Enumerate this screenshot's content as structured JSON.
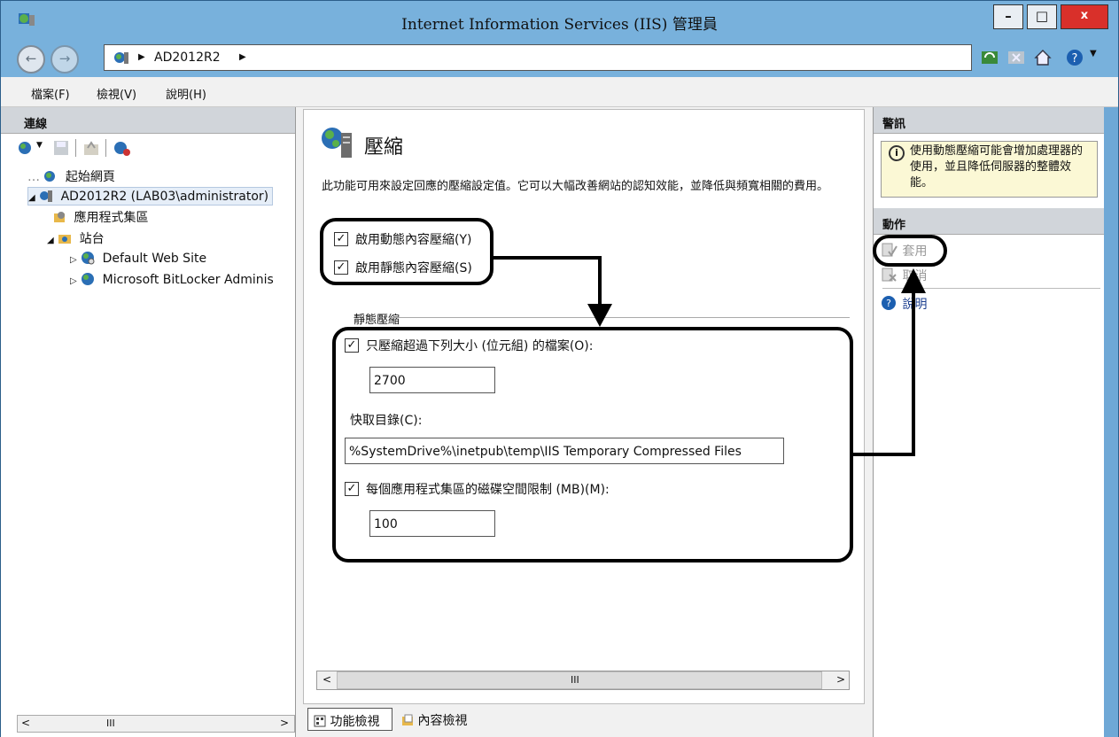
{
  "window": {
    "title": "Internet Information Services (IIS) 管理員",
    "minimize_label": "–",
    "maximize_label": "□",
    "close_label": "x"
  },
  "address": {
    "path": "AD2012R2"
  },
  "menu": {
    "items": [
      "檔案(F)",
      "檢視(V)",
      "說明(H)"
    ]
  },
  "connections": {
    "header": "連線",
    "tree": [
      {
        "label": "起始網頁"
      },
      {
        "label": "AD2012R2 (LAB03\\administrator)"
      },
      {
        "label": "應用程式集區"
      },
      {
        "label": "站台"
      },
      {
        "label": "Default Web Site"
      },
      {
        "label": "Microsoft BitLocker Adminis"
      }
    ],
    "hscroll_thumb": "III"
  },
  "main": {
    "title": "壓縮",
    "description": "此功能可用來設定回應的壓縮設定值。它可以大幅改善網站的認知效能，並降低與頻寬相關的費用。",
    "dynamic_compression": {
      "label": "啟用動態內容壓縮(Y)",
      "checked": true
    },
    "static_compression": {
      "label": "啟用靜態內容壓縮(S)",
      "checked": true
    },
    "static_group_label": "靜態壓縮",
    "min_size": {
      "label": "只壓縮超過下列大小 (位元組) 的檔案(O):",
      "checked": true,
      "value": "2700"
    },
    "cache_dir": {
      "label": "快取目錄(C):",
      "value": "%SystemDrive%\\inetpub\\temp\\IIS Temporary Compressed Files",
      "browse_label": "..."
    },
    "disk_limit": {
      "label": "每個應用程式集區的磁碟空間限制 (MB)(M):",
      "checked": true,
      "value": "100"
    },
    "hscroll_thumb": "III",
    "tabs": [
      "功能檢視",
      "內容檢視"
    ]
  },
  "alerts": {
    "header": "警訊",
    "message": "使用動態壓縮可能會增加處理器的使用，並且降低伺服器的整體效能。"
  },
  "actions": {
    "header": "動作",
    "items": [
      {
        "label": "套用",
        "enabled": false
      },
      {
        "label": "取消",
        "enabled": false
      },
      {
        "label": "說明",
        "enabled": true
      }
    ]
  },
  "colors": {
    "chrome": "#78b1dc",
    "callout": "#000000",
    "alert_bg": "#fbf8d5",
    "help_icon": "#1c5fb0"
  }
}
